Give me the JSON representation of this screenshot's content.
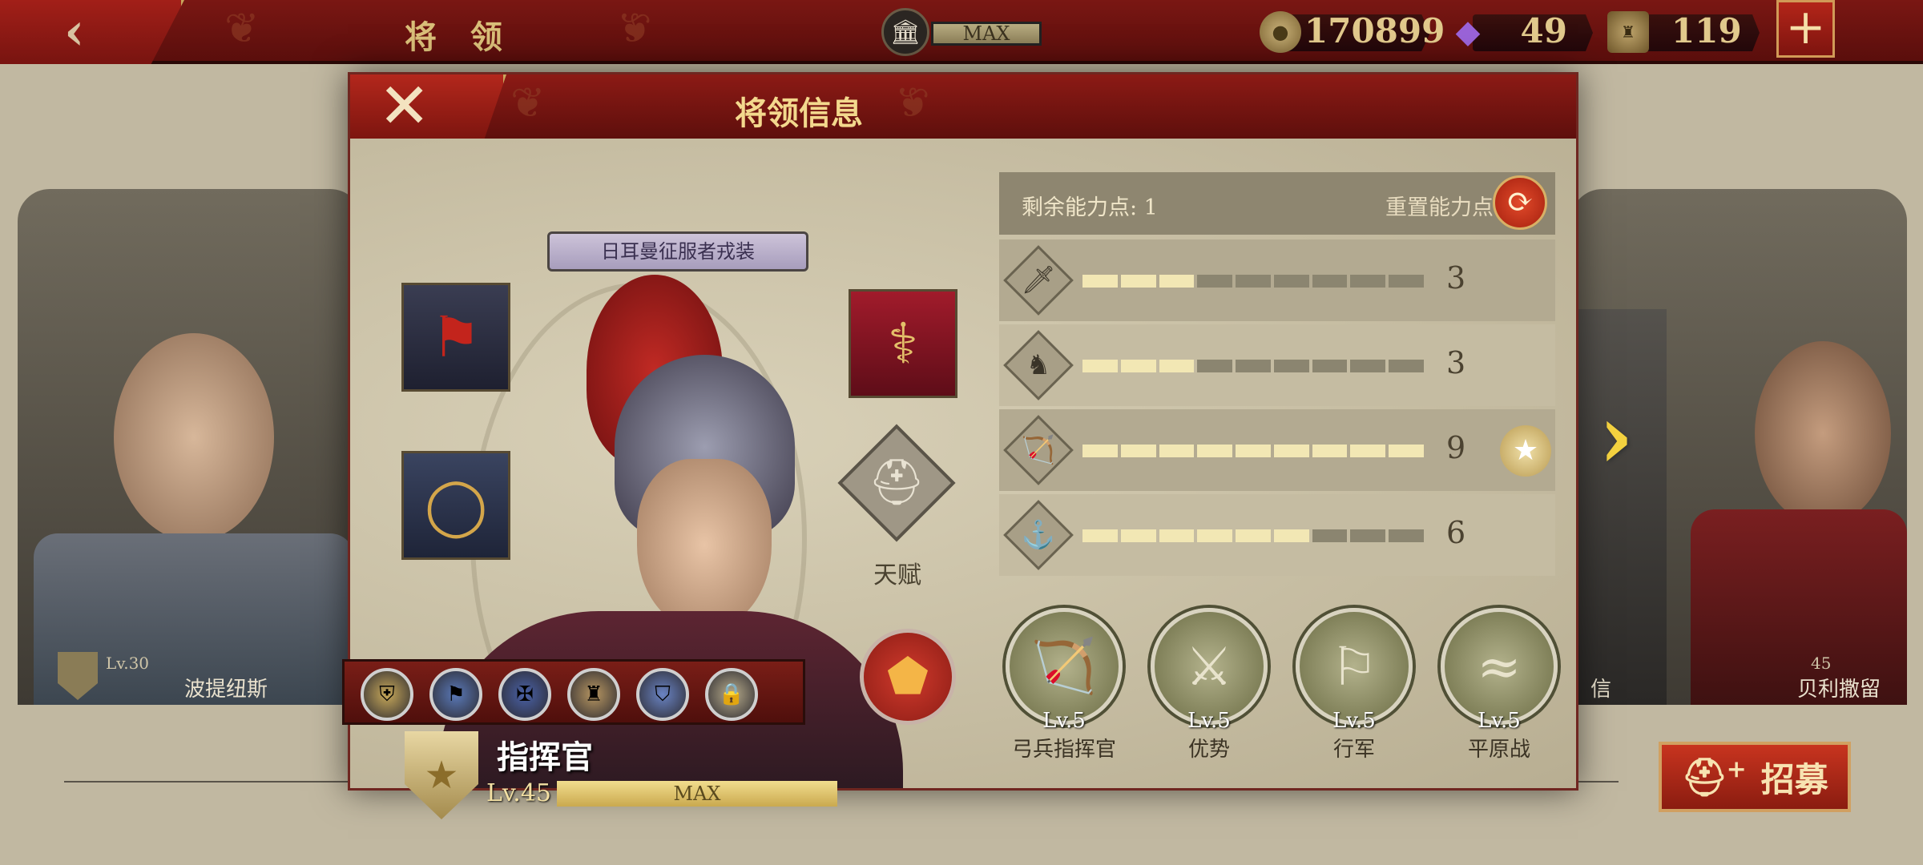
{
  "topbar": {
    "title": "将 领",
    "max_label": "MAX",
    "coins": "170899",
    "gems": "49",
    "spqr": "119",
    "plus": "+"
  },
  "roster": {
    "left_name": "波提纽斯",
    "left_level": "Lv.30",
    "right_partial_name": "信",
    "right_level": "45",
    "right_name": "贝利撒留"
  },
  "modal": {
    "title": "将领信息",
    "close": "✕",
    "costume": "日耳曼征服者戎装",
    "talent_label": "天赋",
    "general_name": "指挥官",
    "level": "Lv.45",
    "level_bar_label": "MAX",
    "skill_medals": [
      "⛨",
      "⚑",
      "✠",
      "♜",
      "⛉",
      "🔒"
    ]
  },
  "stats": {
    "points_label": "剩余能力点: 1",
    "reset_label": "重置能力点",
    "rows": [
      {
        "icon": "sword-icon",
        "glyph": "🗡",
        "value": "3",
        "filled": 3,
        "max": 9
      },
      {
        "icon": "horse-icon",
        "glyph": "♞",
        "value": "3",
        "filled": 3,
        "max": 9
      },
      {
        "icon": "bow-icon",
        "glyph": "🏹",
        "value": "9",
        "filled": 9,
        "max": 9
      },
      {
        "icon": "anchor-icon",
        "glyph": "⚓",
        "value": "6",
        "filled": 6,
        "max": 9
      }
    ]
  },
  "traits": [
    {
      "icon": "bow-icon",
      "glyph": "🏹",
      "level": "Lv.5",
      "name": "弓兵指挥官"
    },
    {
      "icon": "archers-icon",
      "glyph": "⚔",
      "level": "Lv.5",
      "name": "优势"
    },
    {
      "icon": "march-icon",
      "glyph": "⚐",
      "level": "Lv.5",
      "name": "行军"
    },
    {
      "icon": "plain-icon",
      "glyph": "≈",
      "level": "Lv.5",
      "name": "平原战"
    }
  ],
  "recruit": {
    "label": "招募",
    "plus": "+"
  },
  "colors": {
    "accent_red": "#8c1a15",
    "gold": "#e1c98c",
    "stat_on": "#f2e7b4",
    "stat_off": "#8b8570"
  }
}
